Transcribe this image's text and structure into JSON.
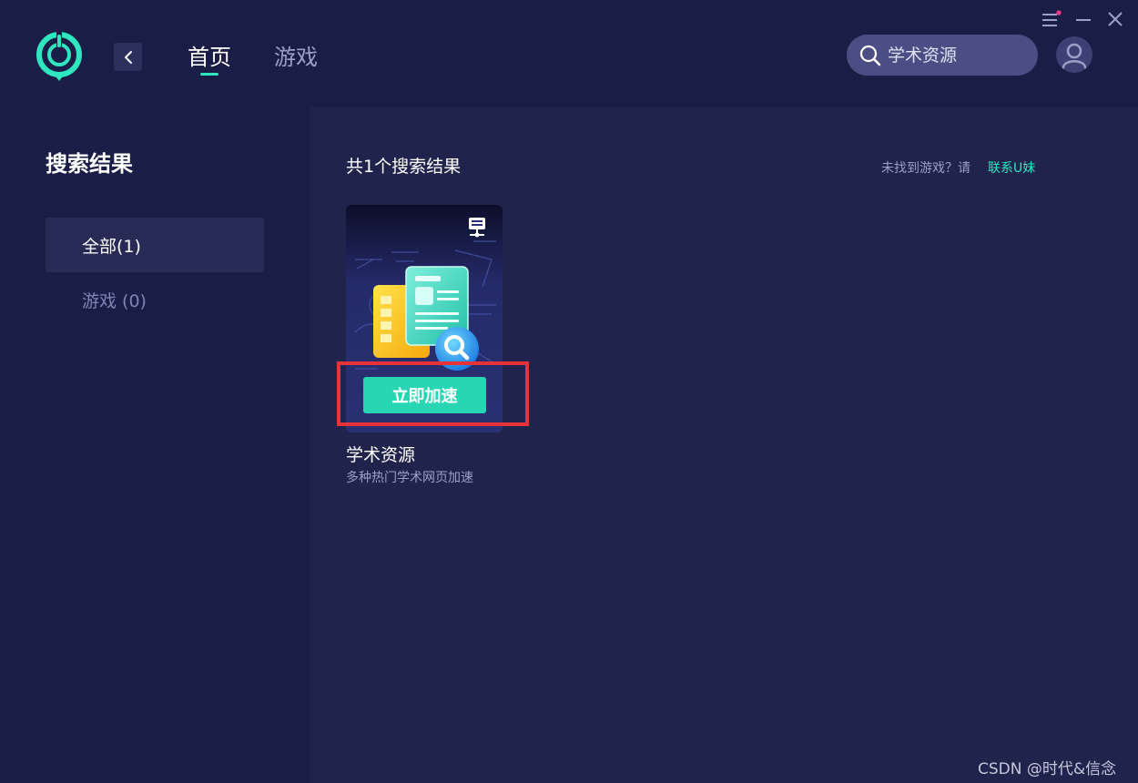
{
  "header": {
    "tabs": [
      {
        "label": "首页",
        "active": true
      },
      {
        "label": "游戏",
        "active": false
      }
    ],
    "search": {
      "placeholder": "学术资源",
      "value": ""
    },
    "icons": [
      "app-logo-icon",
      "back-chevron-icon",
      "search-icon",
      "user-avatar-icon",
      "menu-icon",
      "minimize-icon",
      "close-icon"
    ]
  },
  "sidebar": {
    "title": "搜索结果",
    "items": [
      {
        "label": "全部(1)",
        "active": true
      },
      {
        "label": "游戏 (0)",
        "active": false
      }
    ]
  },
  "main": {
    "result_count": "共1个搜索结果",
    "not_found_text": "未找到游戏？请",
    "contact_link": "联系U妹",
    "cards": [
      {
        "title": "学术资源",
        "description": "多种热门学术网页加速",
        "button_label": "立即加速",
        "platform_icon": "pc-icon"
      }
    ]
  },
  "watermark": "CSDN @时代&信念",
  "colors": {
    "accent": "#2ee6c0",
    "button": "#29d6b3",
    "highlight": "#e8323a",
    "notification_dot": "#ff3d8b",
    "background": "#1c1f47"
  }
}
